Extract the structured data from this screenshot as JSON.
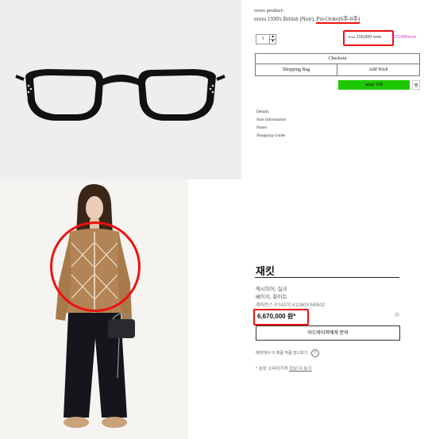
{
  "top": {
    "breadcrumb": "ororo product",
    "breadcrumb_suffix": ":",
    "title_main": "ororo 1930's British",
    "title_variant": "(Noir)",
    "title_preorder": "Pre-Order(6주-8주)",
    "quantity": "1",
    "total_label": "Total",
    "total_value": "250,000 won",
    "sale_price": "225,000won",
    "checkout_label": "Checkout",
    "bag_label": "Shopping Bag",
    "wish_label": "Add Wish",
    "pay_label": "●pay 구매",
    "info_links": [
      "Details",
      "Size Information",
      "Notes",
      "Shopping Guide"
    ]
  },
  "bottom": {
    "product_title": "재킷",
    "material": "캐시미어, 실크",
    "color": "베이지, 화이트",
    "ref_label": "레퍼런스",
    "ref_value": "P74370 K10903 NR602",
    "price": "6,670,000 원*",
    "inquiry_label": "어드바이저에게 문의",
    "store_text": "매장에서 이 제품 작품 만나보기",
    "note_prefix": "* 권장 소비자가격",
    "note_link": "정보 더 보기"
  },
  "colors": {
    "accent_red": "#e11111",
    "pay_green": "#1ec800",
    "sale_magenta": "#cc33cc"
  }
}
